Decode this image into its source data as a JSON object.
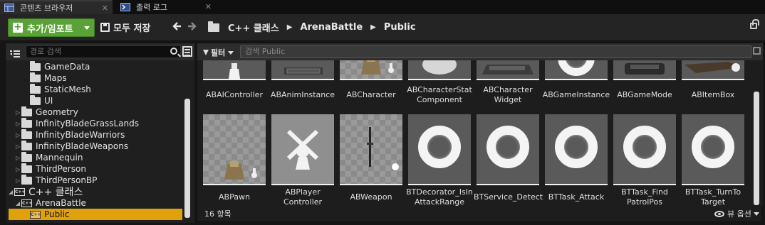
{
  "tabs": [
    {
      "label": "콘텐츠 브라우저",
      "close": "✕"
    },
    {
      "label": "출력 로그",
      "close": "✕"
    }
  ],
  "toolbar": {
    "add_import_label": "추가/임포트",
    "save_all_label": "모두 저장",
    "back_glyph": "◀",
    "forward_glyph": "▶",
    "breadcrumb": [
      "C++ 클래스",
      "ArenaBattle",
      "Public"
    ],
    "breadcrumb_sep": "▶"
  },
  "sources": {
    "search_placeholder": "경로 검색",
    "tree": [
      {
        "label": "GameData",
        "depth": 3,
        "kind": "folder",
        "arrow": ""
      },
      {
        "label": "Maps",
        "depth": 3,
        "kind": "folder",
        "arrow": ""
      },
      {
        "label": "StaticMesh",
        "depth": 3,
        "kind": "folder",
        "arrow": ""
      },
      {
        "label": "UI",
        "depth": 3,
        "kind": "folder",
        "arrow": ""
      },
      {
        "label": "Geometry",
        "depth": 2,
        "kind": "folder",
        "arrow": "▷"
      },
      {
        "label": "InfinityBladeGrassLands",
        "depth": 2,
        "kind": "folder",
        "arrow": "▷"
      },
      {
        "label": "InfinityBladeWarriors",
        "depth": 2,
        "kind": "folder",
        "arrow": "▷"
      },
      {
        "label": "InfinityBladeWeapons",
        "depth": 2,
        "kind": "folder",
        "arrow": "▷"
      },
      {
        "label": "Mannequin",
        "depth": 2,
        "kind": "folder",
        "arrow": "▷"
      },
      {
        "label": "ThirdPerson",
        "depth": 2,
        "kind": "folder",
        "arrow": "▷"
      },
      {
        "label": "ThirdPersonBP",
        "depth": 2,
        "kind": "folder",
        "arrow": "▷"
      },
      {
        "label": "C++ 클래스",
        "depth": 1,
        "kind": "cpp",
        "arrow": "◢",
        "big": true
      },
      {
        "label": "ArenaBattle",
        "depth": 2,
        "kind": "cpp",
        "arrow": "◢"
      },
      {
        "label": "Public",
        "depth": 3,
        "kind": "cpp",
        "arrow": "",
        "selected": true
      }
    ]
  },
  "assets": {
    "filter_label": "필터",
    "search_placeholder": "검색 Public",
    "item_count": "16 항목",
    "view_options_label": "뷰 옵션",
    "items": [
      {
        "label": "ABAIController",
        "thumb": "pawn"
      },
      {
        "label": "ABAnimInstance",
        "thumb": "anim"
      },
      {
        "label": "ABCharacter",
        "thumb": "char"
      },
      {
        "label": "ABCharacterStat Component",
        "thumb": "sphere"
      },
      {
        "label": "ABCharacter Widget",
        "thumb": "widget"
      },
      {
        "label": "ABGameInstance",
        "thumb": "ring"
      },
      {
        "label": "ABGameMode",
        "thumb": "gamemode"
      },
      {
        "label": "ABItemBox",
        "thumb": "box"
      },
      {
        "label": "ABPawn",
        "thumb": "char"
      },
      {
        "label": "ABPlayer Controller",
        "thumb": "controller"
      },
      {
        "label": "ABWeapon",
        "thumb": "weapon"
      },
      {
        "label": "BTDecorator_IsIn AttackRange",
        "thumb": "ring"
      },
      {
        "label": "BTService_Detect",
        "thumb": "ring"
      },
      {
        "label": "BTTask_Attack",
        "thumb": "ring"
      },
      {
        "label": "BTTask_Find PatrolPos",
        "thumb": "ring"
      },
      {
        "label": "BTTask_TurnTo Target",
        "thumb": "ring"
      }
    ]
  },
  "colors": {
    "add_button": "#5aa237",
    "selection": "#e0a10d"
  }
}
